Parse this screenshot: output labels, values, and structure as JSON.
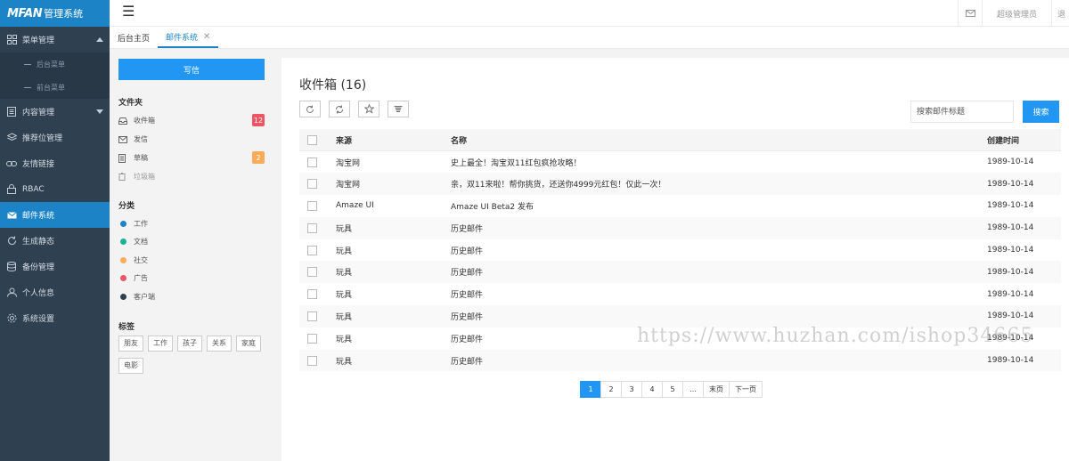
{
  "app": {
    "logo_text": "MFAN",
    "logo_suffix": "管理系统"
  },
  "sidebar": {
    "items": [
      {
        "label": "菜单管理",
        "icon": "grid-icon",
        "expanded": true,
        "children": [
          {
            "label": "后台菜单"
          },
          {
            "label": "前台菜单"
          }
        ]
      },
      {
        "label": "内容管理",
        "icon": "document-icon",
        "collapsed": true
      },
      {
        "label": "推荐位管理",
        "icon": "layers-icon"
      },
      {
        "label": "友情链接",
        "icon": "link-icon"
      },
      {
        "label": "RBAC",
        "icon": "lock-icon"
      },
      {
        "label": "邮件系统",
        "icon": "mail-icon",
        "active": true
      },
      {
        "label": "生成静态",
        "icon": "refresh-icon"
      },
      {
        "label": "备份管理",
        "icon": "database-icon"
      },
      {
        "label": "个人信息",
        "icon": "user-icon"
      },
      {
        "label": "系统设置",
        "icon": "gear-icon"
      }
    ]
  },
  "header": {
    "menu_icon": "hamburger-icon",
    "mail_icon": "envelope-icon",
    "user_label": "超级管理员",
    "logout_partial": "退"
  },
  "tabs": [
    {
      "label": "后台主页",
      "active": false
    },
    {
      "label": "邮件系统",
      "active": true,
      "closable": true
    }
  ],
  "mailnav": {
    "write_label": "写信",
    "folders_title": "文件夹",
    "folders": [
      {
        "label": "收件箱",
        "icon": "inbox-icon",
        "badge": "12",
        "badge_color": "#ed5565"
      },
      {
        "label": "发信",
        "icon": "envelope-icon"
      },
      {
        "label": "草稿",
        "icon": "file-icon",
        "badge": "2",
        "badge_color": "#f8ac59"
      },
      {
        "label": "垃圾箱",
        "icon": "trash-icon"
      }
    ],
    "categories_title": "分类",
    "categories": [
      {
        "label": "工作",
        "color": "#1c84c6"
      },
      {
        "label": "文档",
        "color": "#1ab394"
      },
      {
        "label": "社交",
        "color": "#f8ac59"
      },
      {
        "label": "广告",
        "color": "#ed5565"
      },
      {
        "label": "客户端",
        "color": "#2f4050"
      }
    ],
    "tags_title": "标签",
    "tags": [
      "朋友",
      "工作",
      "孩子",
      "关系",
      "家庭",
      "电影"
    ]
  },
  "inbox": {
    "title": "收件箱 (16)",
    "toolbar": [
      "refresh-icon",
      "sync-icon",
      "star-icon",
      "trash-icon"
    ],
    "search_placeholder": "搜索邮件标题",
    "search_button": "搜索",
    "columns": {
      "from": "来源",
      "name": "名称",
      "date": "创建时间"
    },
    "rows": [
      {
        "from": "淘宝网",
        "name": "史上最全！淘宝双11红包疯抢攻略！",
        "date": "1989-10-14"
      },
      {
        "from": "淘宝网",
        "name": "亲，双11来啦！帮你挑货，还送你4999元红包！仅此一次！",
        "date": "1989-10-14"
      },
      {
        "from": "Amaze UI",
        "name": "Amaze UI Beta2 发布",
        "date": "1989-10-14"
      },
      {
        "from": "玩具",
        "name": "历史邮件",
        "date": "1989-10-14"
      },
      {
        "from": "玩具",
        "name": "历史邮件",
        "date": "1989-10-14"
      },
      {
        "from": "玩具",
        "name": "历史邮件",
        "date": "1989-10-14"
      },
      {
        "from": "玩具",
        "name": "历史邮件",
        "date": "1989-10-14"
      },
      {
        "from": "玩具",
        "name": "历史邮件",
        "date": "1989-10-14"
      },
      {
        "from": "玩具",
        "name": "历史邮件",
        "date": "1989-10-14"
      },
      {
        "from": "玩具",
        "name": "历史邮件",
        "date": "1989-10-14"
      }
    ],
    "pagination": [
      {
        "label": "1",
        "active": true
      },
      {
        "label": "2"
      },
      {
        "label": "3"
      },
      {
        "label": "4"
      },
      {
        "label": "5"
      },
      {
        "label": "..."
      },
      {
        "label": "末页"
      },
      {
        "label": "下一页"
      }
    ]
  },
  "watermark": "https://www.huzhan.com/ishop34665"
}
